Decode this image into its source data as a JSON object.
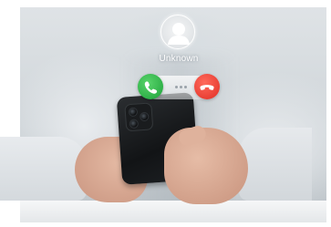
{
  "scene": {
    "description_icons": {
      "avatar": "person-silhouette-icon",
      "accept": "phone-accept-icon",
      "decline": "phone-decline-icon"
    },
    "colors": {
      "accept": "#2bbf48",
      "decline": "#f0453a",
      "label": "#ffffff"
    }
  },
  "call": {
    "caller_name": "Unknown"
  }
}
